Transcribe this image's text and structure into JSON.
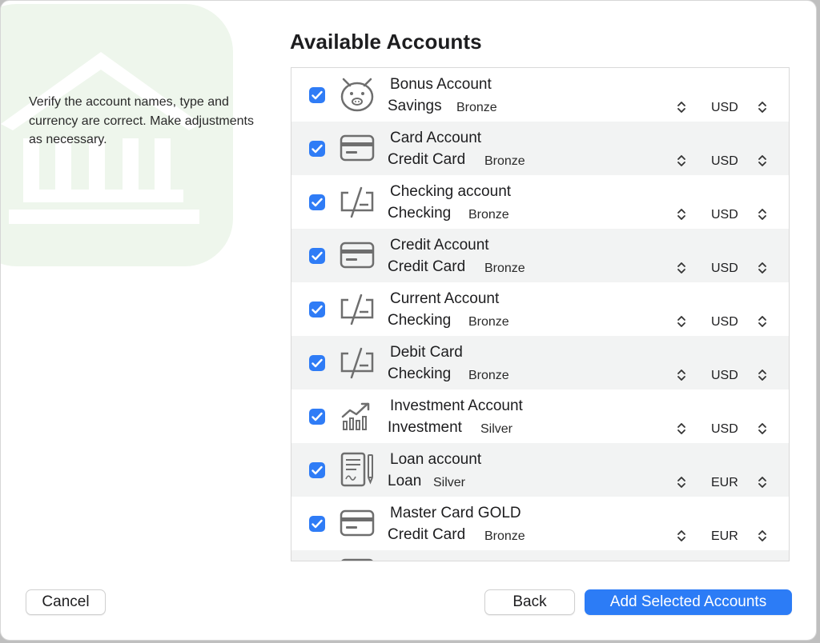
{
  "dialog": {
    "title": "Available Accounts",
    "instructions": "Verify the account names, type and currency are correct. Make adjustments as necessary."
  },
  "accounts": [
    {
      "name": "Bonus Account",
      "type": "Savings",
      "tier": "Bronze",
      "currency": "USD",
      "checked": true,
      "icon": "piggy-bank-icon"
    },
    {
      "name": "Card Account",
      "type": "Credit Card",
      "tier": "Bronze",
      "currency": "USD",
      "checked": true,
      "icon": "credit-card-icon"
    },
    {
      "name": "Checking account",
      "type": "Checking",
      "tier": "Bronze",
      "currency": "USD",
      "checked": true,
      "icon": "check-icon"
    },
    {
      "name": "Credit Account",
      "type": "Credit Card",
      "tier": "Bronze",
      "currency": "USD",
      "checked": true,
      "icon": "credit-card-icon"
    },
    {
      "name": "Current Account",
      "type": "Checking",
      "tier": "Bronze",
      "currency": "USD",
      "checked": true,
      "icon": "check-icon"
    },
    {
      "name": "Debit Card",
      "type": "Checking",
      "tier": "Bronze",
      "currency": "USD",
      "checked": true,
      "icon": "check-icon"
    },
    {
      "name": "Investment Account",
      "type": "Investment",
      "tier": "Silver",
      "currency": "USD",
      "checked": true,
      "icon": "investment-chart-icon"
    },
    {
      "name": "Loan account",
      "type": "Loan",
      "tier": "Silver",
      "currency": "EUR",
      "checked": true,
      "icon": "loan-contract-icon"
    },
    {
      "name": "Master Card GOLD",
      "type": "Credit Card",
      "tier": "Bronze",
      "currency": "EUR",
      "checked": true,
      "icon": "credit-card-icon"
    }
  ],
  "buttons": {
    "cancel": "Cancel",
    "back": "Back",
    "add": "Add Selected Accounts"
  },
  "colors": {
    "accent": "#2c7cf6",
    "row_alt": "#f2f3f3"
  }
}
